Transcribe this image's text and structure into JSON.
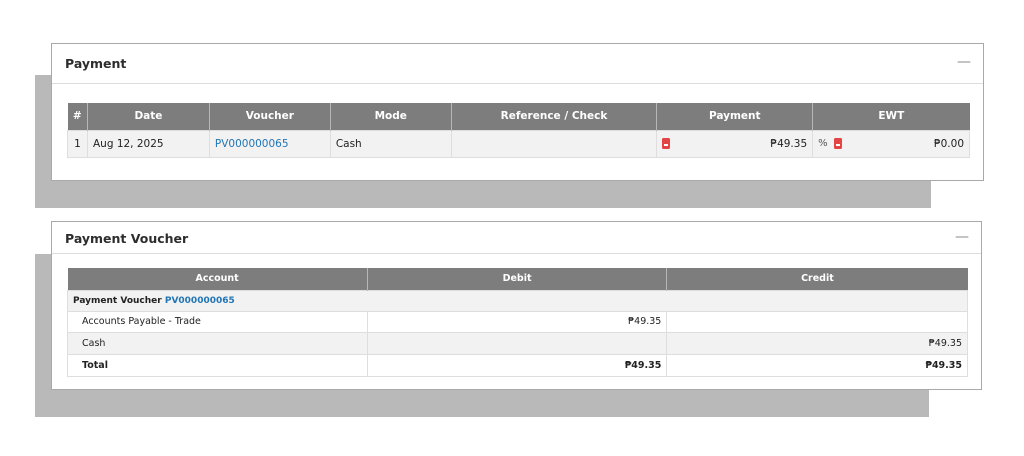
{
  "payment_panel": {
    "title": "Payment",
    "collapse_label": "—",
    "columns": [
      "#",
      "Date",
      "Voucher",
      "Mode",
      "Reference / Check",
      "Payment",
      "EWT"
    ],
    "row": {
      "num": "1",
      "date": "Aug 12, 2025",
      "voucher": "PV000000065",
      "mode": "Cash",
      "reference": "",
      "payment": "₱49.35",
      "ewt_percent": "%",
      "ewt": "₱0.00"
    },
    "icons": [
      "pdf-icon",
      "percent-icon"
    ]
  },
  "voucher_panel": {
    "title": "Payment Voucher",
    "collapse_label": "—",
    "columns": [
      "Account",
      "Debit",
      "Credit"
    ],
    "header_row": {
      "label": "Payment Voucher",
      "voucher": "PV000000065"
    },
    "rows": [
      {
        "account": "Accounts Payable - Trade",
        "debit": "₱49.35",
        "credit": ""
      },
      {
        "account": "Cash",
        "debit": "",
        "credit": "₱49.35"
      }
    ],
    "total": {
      "label": "Total",
      "debit": "₱49.35",
      "credit": "₱49.35"
    }
  },
  "colors": {
    "header_bg": "#7d7d7d",
    "link": "#2276b5",
    "pdf_icon": "#e34444",
    "shadow": "#b9b9b9"
  }
}
